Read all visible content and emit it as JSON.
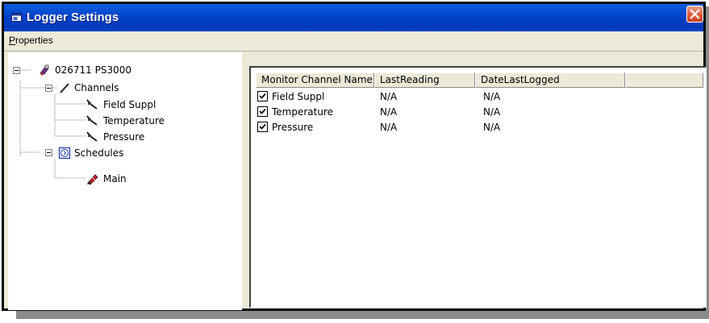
{
  "window": {
    "title": "Logger Settings",
    "close_icon": "close-icon"
  },
  "menu": {
    "properties": "Properties"
  },
  "tree": {
    "root": {
      "label": "026711 PS3000",
      "icon": "logger-device-icon"
    },
    "channels": {
      "label": "Channels",
      "icon": "channels-icon",
      "items": [
        {
          "label": "Field Suppl",
          "icon": "probe-icon"
        },
        {
          "label": "Temperature",
          "icon": "probe-icon"
        },
        {
          "label": "Pressure",
          "icon": "probe-icon"
        }
      ]
    },
    "schedules": {
      "label": "Schedules",
      "icon": "schedule-icon",
      "items": [
        {
          "label": "Main",
          "icon": "schedule-item-icon"
        }
      ]
    }
  },
  "list": {
    "columns": [
      "Monitor Channel Name",
      "LastReading",
      "DateLastLogged"
    ],
    "rows": [
      {
        "name": "Field Suppl",
        "checked": true,
        "last_reading": "N/A",
        "date_last_logged": "N/A"
      },
      {
        "name": "Temperature",
        "checked": true,
        "last_reading": "N/A",
        "date_last_logged": "N/A"
      },
      {
        "name": "Pressure",
        "checked": true,
        "last_reading": "N/A",
        "date_last_logged": "N/A"
      }
    ]
  },
  "colors": {
    "titlebar": "#0042c8",
    "close_button": "#e05a36",
    "window_bg": "#ece9d8"
  }
}
